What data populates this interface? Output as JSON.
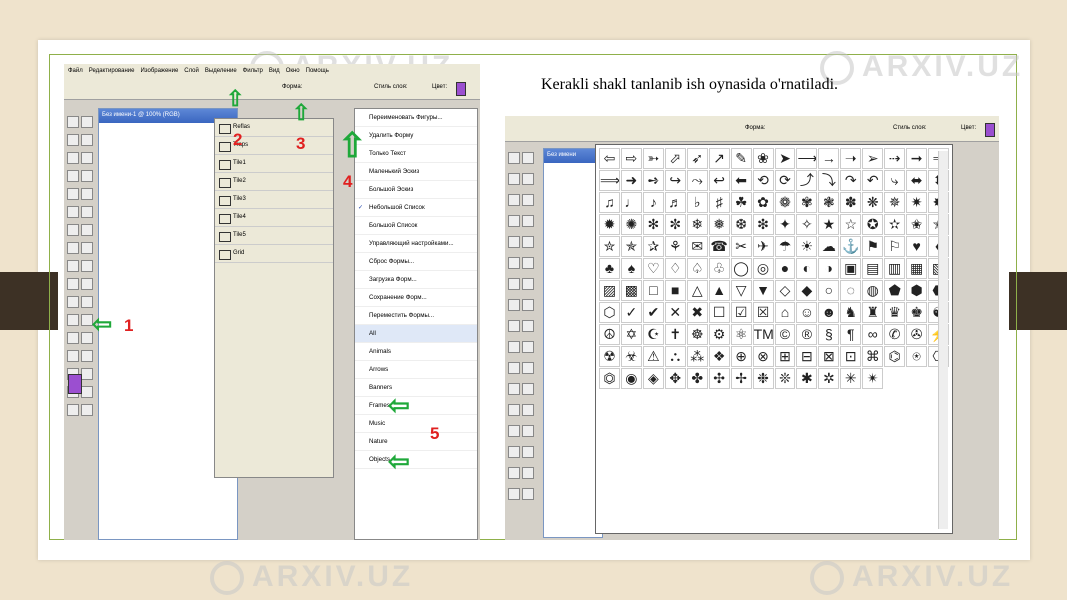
{
  "caption": "Kerakli shakl tanlanib ish oynasida o'rnatiladi.",
  "watermark": "ARXIV.UZ",
  "menu": [
    "Файл",
    "Редактирование",
    "Изображение",
    "Слой",
    "Выделение",
    "Фильтр",
    "Вид",
    "Окно",
    "Помощь"
  ],
  "options": {
    "shape_label": "Форма:",
    "style_label": "Стиль слоя:",
    "color_label": "Цвет:"
  },
  "doc_title": "Без имени-1 @ 100% (RGB)",
  "doc_title_b": "Без имени",
  "shape_sets": [
    "Reflas",
    "Traps",
    "Tile1",
    "Tile2",
    "Tile3",
    "Tile4",
    "Tile5",
    "Grid"
  ],
  "context_menu": [
    "Переименовать Фигуры...",
    "Удалить Форму",
    "Только Текст",
    "Маленький Эскиз",
    "Большой Эскиз",
    "Небольшой Список",
    "Большой Список",
    "Управляющий настройками...",
    "Сброс Формы...",
    "Загрузка Форм...",
    "Сохранение Форм...",
    "Переместить Формы...",
    "All",
    "Animals",
    "Arrows",
    "Banners",
    "Frames",
    "Music",
    "Nature",
    "Objects"
  ],
  "checked_item": "Небольшой Список",
  "selected_item": "All",
  "numbers": [
    "1",
    "2",
    "3",
    "4",
    "5"
  ],
  "accent_color": "#9b4fd0",
  "shape_glyphs": [
    "⇦",
    "⇨",
    "➳",
    "⬀",
    "➶",
    "↗",
    "✎",
    "❀",
    "➤",
    "⟶",
    "→",
    "➝",
    "➢",
    "⇢",
    "➞",
    "➾",
    "⟹",
    "➜",
    "➺",
    "↪",
    "⤳",
    "↩",
    "⬅",
    "⟲",
    "⟳",
    "⤴",
    "⤵",
    "↷",
    "↶",
    "⤷",
    "⬌",
    "⬍",
    "♫",
    "♩",
    "♪",
    "♬",
    "♭",
    "♯",
    "☘",
    "✿",
    "❁",
    "✾",
    "❃",
    "✽",
    "❋",
    "✵",
    "✷",
    "✸",
    "✹",
    "✺",
    "✻",
    "✼",
    "❄",
    "❅",
    "❆",
    "❇",
    "✦",
    "✧",
    "★",
    "☆",
    "✪",
    "✫",
    "✬",
    "✭",
    "✮",
    "✯",
    "✰",
    "⚘",
    "✉",
    "☎",
    "✂",
    "✈",
    "☂",
    "☀",
    "☁",
    "⚓",
    "⚑",
    "⚐",
    "♥",
    "♦",
    "♣",
    "♠",
    "♡",
    "♢",
    "♤",
    "♧",
    "◯",
    "◎",
    "●",
    "◐",
    "◑",
    "▣",
    "▤",
    "▥",
    "▦",
    "▧",
    "▨",
    "▩",
    "□",
    "■",
    "△",
    "▲",
    "▽",
    "▼",
    "◇",
    "◆",
    "○",
    "◌",
    "◍",
    "⬟",
    "⬢",
    "⬣",
    "⬡",
    "✓",
    "✔",
    "✕",
    "✖",
    "☐",
    "☑",
    "☒",
    "⌂",
    "☺",
    "☻",
    "♞",
    "♜",
    "♛",
    "♚",
    "☯",
    "☮",
    "✡",
    "☪",
    "✝",
    "☸",
    "⚙",
    "⚛",
    "TM",
    "©",
    "®",
    "§",
    "¶",
    "∞",
    "✆",
    "✇",
    "⚡",
    "☢",
    "☣",
    "⚠",
    "⛬",
    "⁂",
    "❖",
    "⊕",
    "⊗",
    "⊞",
    "⊟",
    "⊠",
    "⊡",
    "⌘",
    "⌬",
    "⍟",
    "⎔",
    "⏣",
    "◉",
    "◈",
    "✥",
    "✤",
    "✣",
    "✢",
    "❉",
    "❊",
    "✱",
    "✲",
    "✳",
    "✴"
  ]
}
